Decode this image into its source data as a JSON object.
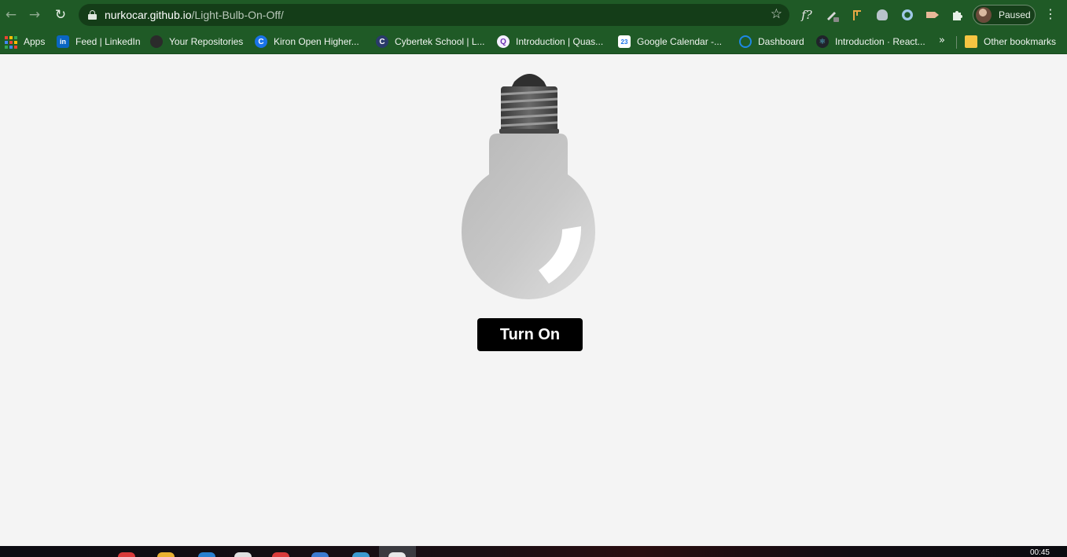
{
  "browser": {
    "url_host": "nurkocar.github.io",
    "url_path": "/Light-Bulb-On-Off/",
    "profile_label": "Paused",
    "extension_fx_label": "f?"
  },
  "bookmarks": {
    "items": [
      {
        "label": "Apps"
      },
      {
        "label": "Feed | LinkedIn"
      },
      {
        "label": "Your Repositories"
      },
      {
        "label": "Kiron Open Higher..."
      },
      {
        "label": "Cybertek School | L..."
      },
      {
        "label": "Introduction | Quas..."
      },
      {
        "label": "Google Calendar -..."
      },
      {
        "label": "Dashboard"
      },
      {
        "label": "Introduction · React..."
      }
    ],
    "more_label": "»",
    "other_label": "Other bookmarks"
  },
  "page": {
    "button_label": "Turn On",
    "bulb_state": "off"
  },
  "taskbar": {
    "clock": "00:45"
  },
  "colors": {
    "chrome_theme": "#1f5a26",
    "page_background": "#f4f4f4",
    "button_background": "#000000",
    "button_text": "#ffffff"
  }
}
